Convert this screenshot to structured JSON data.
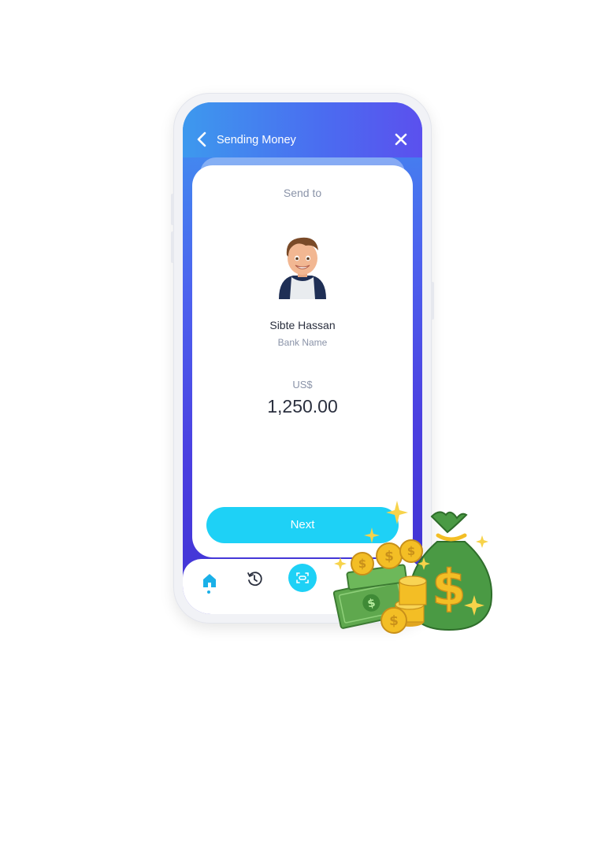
{
  "header": {
    "title": "Sending Money",
    "back_icon": "chevron-left-icon",
    "close_icon": "close-icon"
  },
  "card": {
    "send_to_label": "Send to",
    "recipient_name": "Sibte Hassan",
    "bank_name": "Bank Name",
    "currency": "US$",
    "amount": "1,250.00",
    "next_label": "Next"
  },
  "bottom_nav": {
    "items": [
      {
        "icon": "home-icon",
        "active": true
      },
      {
        "icon": "history-icon",
        "active": false
      },
      {
        "icon": "scan-icon",
        "active": false
      }
    ]
  },
  "colors": {
    "header_start": "#3d99ee",
    "header_end": "#5b50ee",
    "accent": "#1ed1f6",
    "text_primary": "#2a2f3e",
    "text_secondary": "#8a93a8",
    "money_green": "#4a9a44",
    "coin_gold": "#f3be25"
  }
}
